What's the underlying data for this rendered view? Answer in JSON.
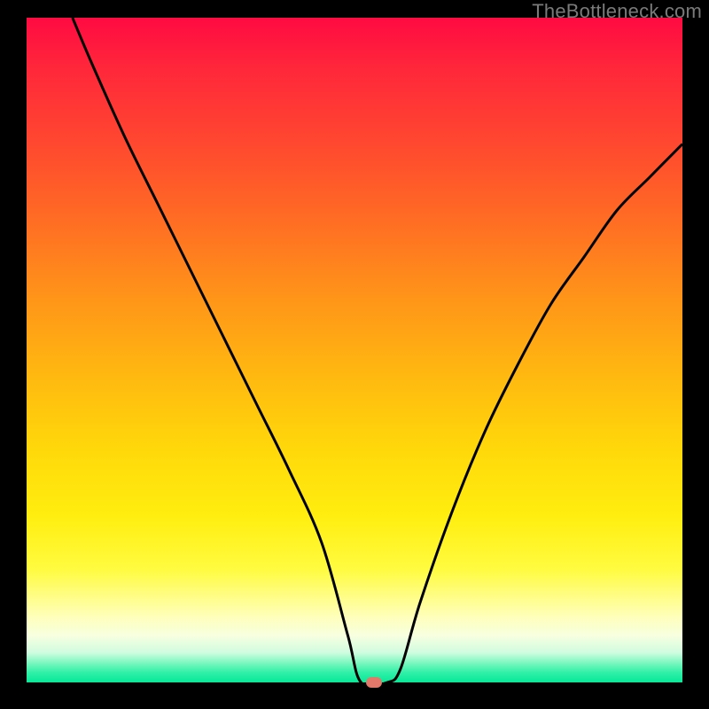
{
  "watermark": "TheBottleneck.com",
  "colors": {
    "curve": "#000000",
    "marker": "#e2786a",
    "frame": "#000000"
  },
  "chart_data": {
    "type": "line",
    "title": "",
    "xlabel": "",
    "ylabel": "",
    "xlim": [
      0,
      100
    ],
    "ylim": [
      0,
      100
    ],
    "grid": false,
    "legend": false,
    "background_gradient": {
      "top": "#ff0a42",
      "middle": "#ffee0f",
      "bottom": "#06e898"
    },
    "annotations": [
      {
        "name": "marker",
        "x": 53,
        "y": 0,
        "color": "#e2786a"
      }
    ],
    "series": [
      {
        "name": "bottleneck-curve",
        "color": "#000000",
        "x": [
          7,
          10,
          15,
          20,
          25,
          30,
          35,
          40,
          45,
          49,
          51,
          55,
          57,
          60,
          65,
          70,
          75,
          80,
          85,
          90,
          95,
          100
        ],
        "y": [
          100,
          93,
          82,
          72,
          62,
          52,
          42,
          32,
          21,
          7,
          0,
          0,
          2,
          12,
          26,
          38,
          48,
          57,
          64,
          71,
          76,
          81
        ]
      }
    ]
  }
}
